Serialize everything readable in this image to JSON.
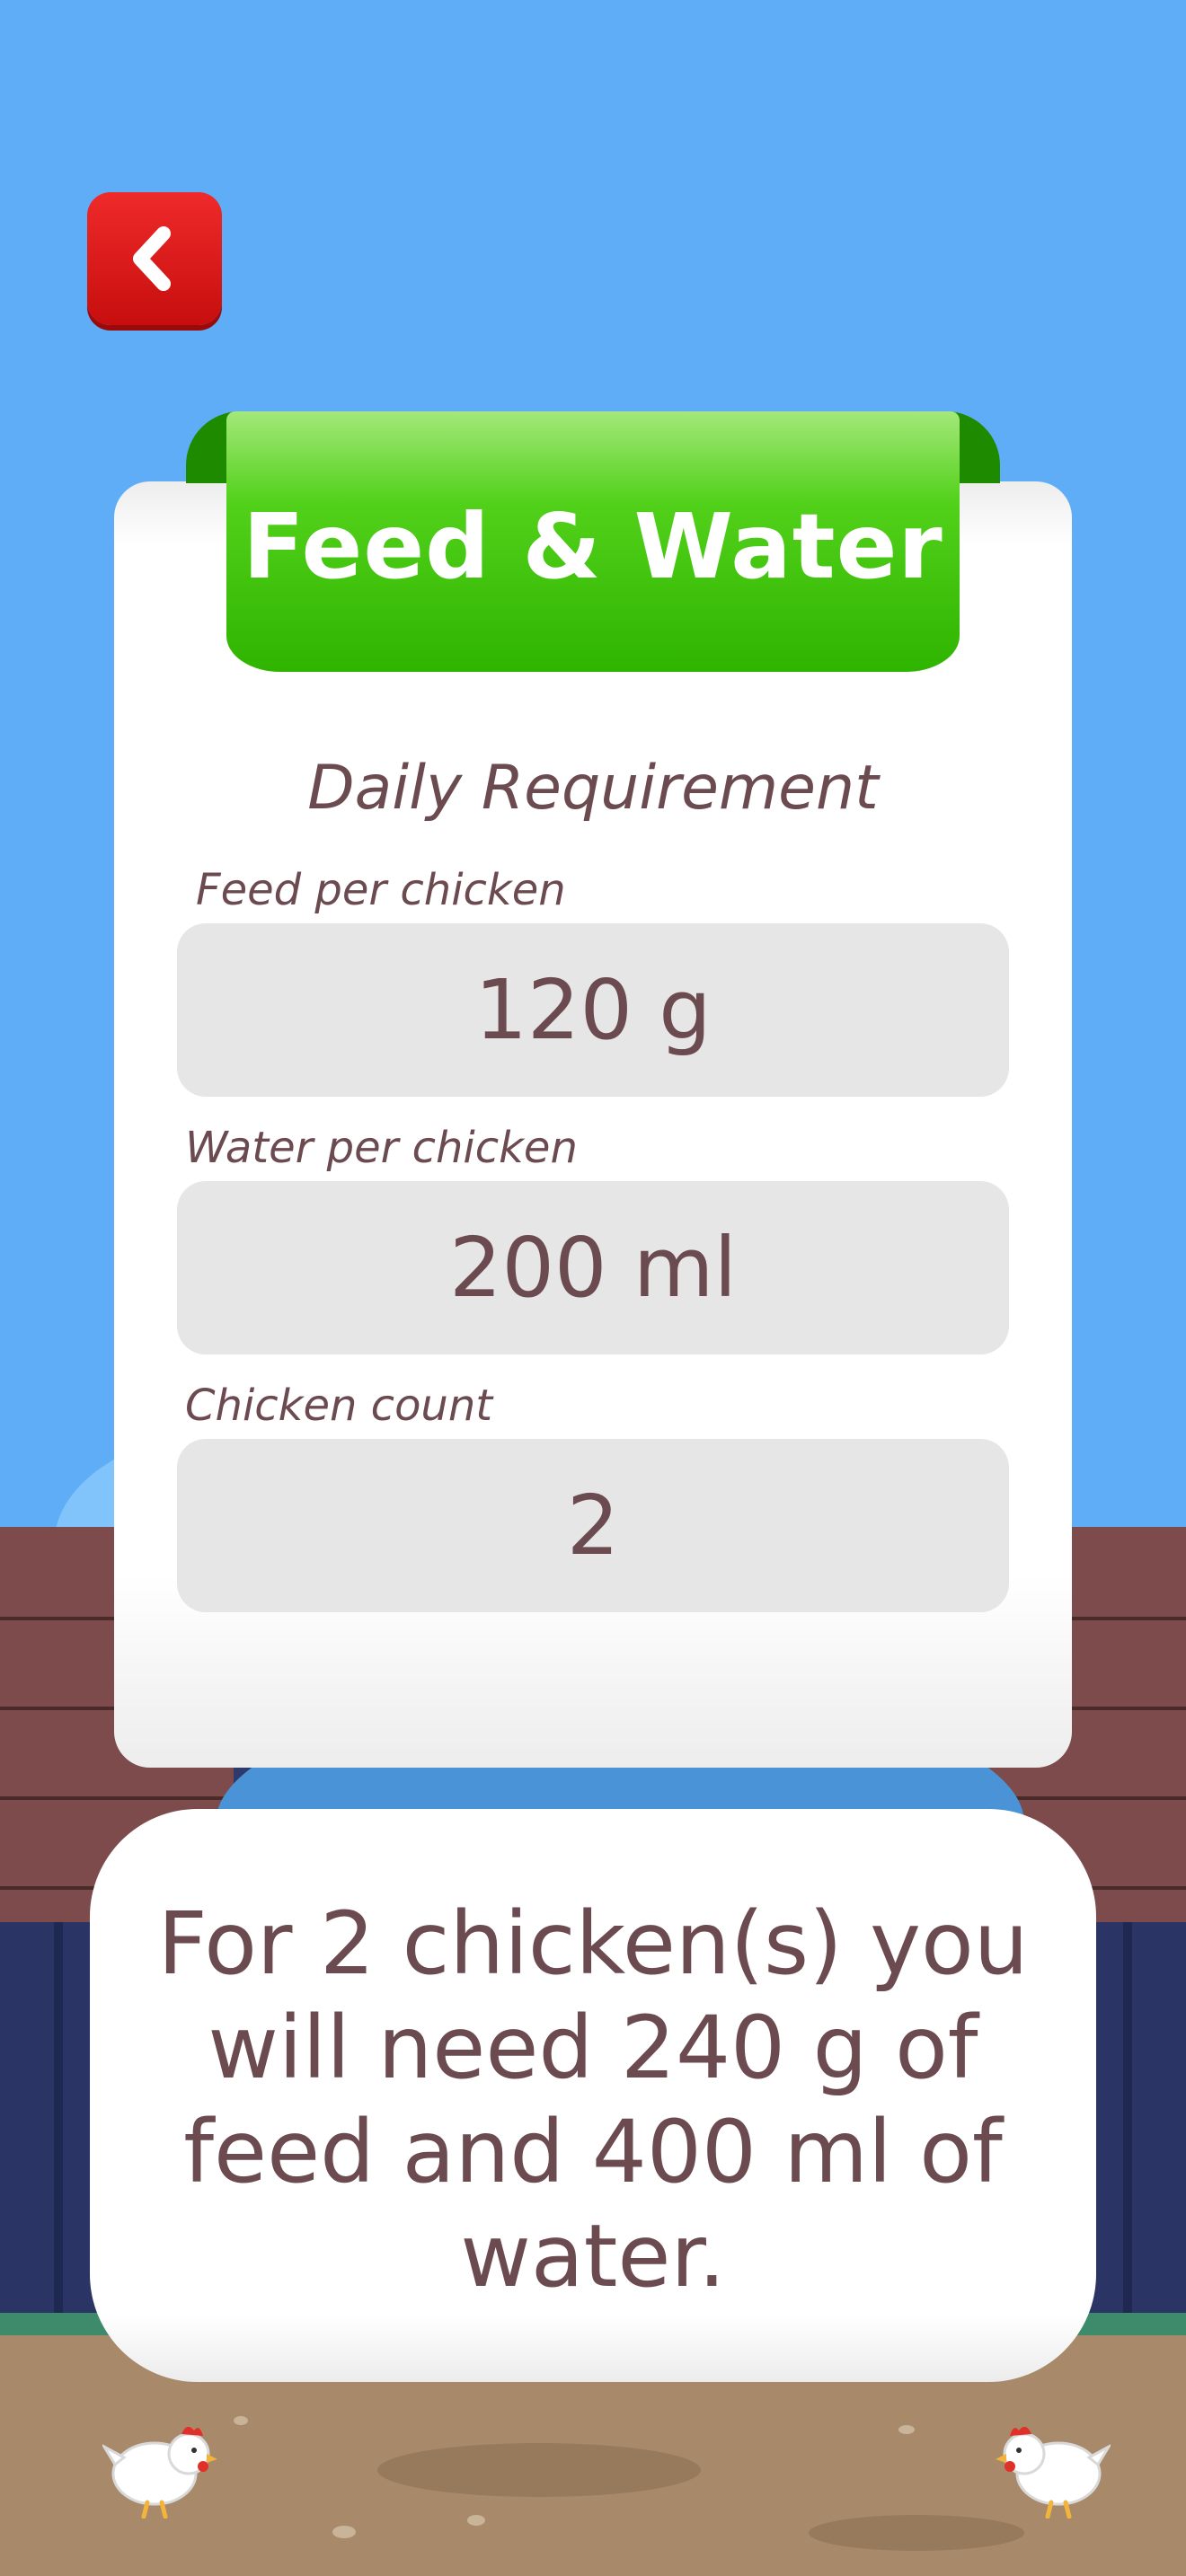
{
  "header": {
    "back_icon": "chevron-left-icon"
  },
  "card": {
    "title": "Feed & Water",
    "subtitle": "Daily Requirement",
    "fields": [
      {
        "label": "Feed per chicken",
        "value": "120 g"
      },
      {
        "label": "Water per chicken",
        "value": "200 ml"
      },
      {
        "label": "Chicken count",
        "value": "2"
      }
    ]
  },
  "result": {
    "text": "For 2 chicken(s) you will need 240 g of feed and 400 ml of water."
  },
  "colors": {
    "sky": "#5eadf6",
    "back_button": "#e21a1a",
    "ribbon": "#3fc00a",
    "text": "#6b4a50",
    "field_bg": "#e6e6e6"
  },
  "decor": {
    "chicken_icon": "chicken-icon"
  }
}
